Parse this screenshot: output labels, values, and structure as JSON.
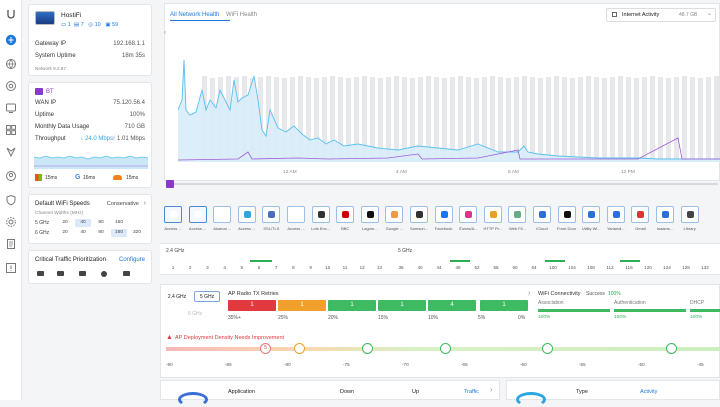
{
  "rail": {
    "icons": [
      "network-icon",
      "globe-icon",
      "target-icon",
      "devices-icon",
      "grid-icon",
      "topology-icon",
      "clients-icon",
      "shield-icon",
      "settings-icon",
      "docs-icon",
      "alarm-icon"
    ]
  },
  "gateway": {
    "name": "HostiFi",
    "stat1": "1",
    "stat2": "7",
    "stat3": "10",
    "stat4": "59",
    "ip_label": "Gateway IP",
    "ip": "192.168.1.1",
    "uptime_label": "System Uptime",
    "uptime": "18m 35s",
    "version": "Network 9.2.87"
  },
  "wan": {
    "isp": "BT",
    "ip_label": "WAN IP",
    "ip": "75.120.56.4",
    "uptime_label": "Uptime",
    "uptime": "100%",
    "usage_label": "Monthly Data Usage",
    "usage": "710 GB",
    "tp_label": "Throughput",
    "down": "↓ 24.0 Mbps",
    "up": "↑ 1.01 Mbps",
    "latency": [
      "15ms",
      "16ms",
      "15ms"
    ]
  },
  "wifi": {
    "title": "Default WiFi Speeds",
    "mode": "Conservative",
    "sub": "Channel Widths (MHz)",
    "b5_label": "5 GHz",
    "b5": [
      "20",
      "40",
      "80",
      "160"
    ],
    "b6_label": "6 GHz",
    "b6": [
      "20",
      "40",
      "80",
      "160",
      "320"
    ]
  },
  "ctp": {
    "title": "Critical Traffic Prioritization",
    "configure": "Configure"
  },
  "main": {
    "tab1": "All Network Health",
    "tab2": "WiFi Health",
    "activity": "Internet Activity",
    "activity_value": "48.7 GB",
    "times": [
      "12 AM",
      "4 AM",
      "8 AM",
      "12 PM"
    ]
  },
  "apps": [
    {
      "label": "Access ..."
    },
    {
      "label": "Access ..."
    },
    {
      "label": "Akamai ..."
    },
    {
      "label": "Access ..."
    },
    {
      "label": "SSL/TLS"
    },
    {
      "label": "Access ..."
    },
    {
      "label": "Lots Enc..."
    },
    {
      "label": "BBC"
    },
    {
      "label": "Lagom..."
    },
    {
      "label": "Google ..."
    },
    {
      "label": "Samsun..."
    },
    {
      "label": "Facebook"
    },
    {
      "label": "iTunes/A..."
    },
    {
      "label": "HTTP Pr..."
    },
    {
      "label": "Web Fil..."
    },
    {
      "label": "iCloud"
    },
    {
      "label": "Front Door"
    },
    {
      "label": "Utility Wi..."
    },
    {
      "label": "Yarlandi..."
    },
    {
      "label": "Gmail"
    },
    {
      "label": "Isaams..."
    },
    {
      "label": "Library"
    }
  ],
  "channels": {
    "b24": "2.4 GHz",
    "b5": "5 GHz",
    "ch24": [
      "1",
      "2",
      "3",
      "4",
      "5",
      "6",
      "7",
      "8",
      "9",
      "10",
      "11",
      "12",
      "13"
    ],
    "ch5": [
      "36",
      "40",
      "44",
      "48",
      "52",
      "56",
      "60",
      "64",
      "100",
      "104",
      "108",
      "112",
      "116",
      "120",
      "124",
      "128",
      "132"
    ]
  },
  "radio": {
    "band1": "2.4 GHz",
    "band2": "5 GHz",
    "band3": "6 GHz",
    "title": "AP Radio TX Retries",
    "boxes": [
      "1",
      "1",
      "1",
      "1",
      "4",
      "1"
    ],
    "pcts": [
      "35%+",
      "25%",
      "20%",
      "15%",
      "10%",
      "5%",
      "0%"
    ]
  },
  "conn": {
    "title": "WiFi Connectivity",
    "success_label": "Success",
    "success": "100%",
    "cols": [
      {
        "name": "Association",
        "val": "100%"
      },
      {
        "name": "Authentication",
        "val": "100%"
      },
      {
        "name": "DHCP",
        "val": "100%"
      }
    ]
  },
  "density": {
    "warning": "AP Deployment Density Needs Improvement",
    "scale": [
      "-90",
      "-85",
      "-80",
      "-75",
      "-70",
      "-65",
      "-60",
      "-55",
      "-50",
      "-45"
    ],
    "marker": "5"
  },
  "footer": {
    "col1": "Application",
    "col2": "Down",
    "col3": "Up",
    "col4": "Traffic",
    "col5": "Type",
    "col6": "Activity"
  }
}
